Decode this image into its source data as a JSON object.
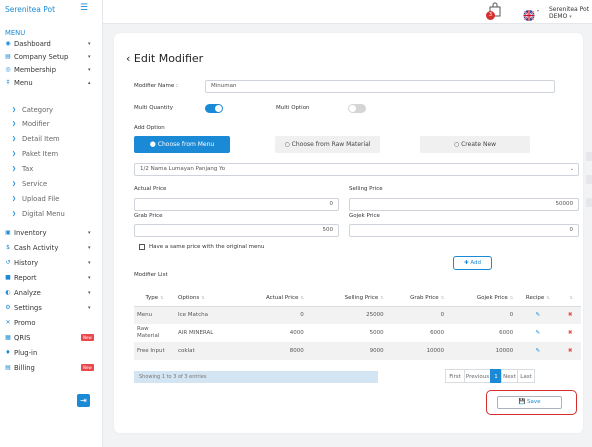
{
  "sidebar": {
    "brand": "Serenitea Pot",
    "menu_heading": "MENU",
    "items": [
      {
        "label": "Dashboard",
        "icon": "◉",
        "caret": "▾",
        "new": ""
      },
      {
        "label": "Company Setup",
        "icon": "▤",
        "caret": "▾",
        "new": ""
      },
      {
        "label": "Membership",
        "icon": "◎",
        "caret": "▾",
        "new": ""
      },
      {
        "label": "Menu",
        "icon": "‡",
        "caret": "▴",
        "new": ""
      },
      {
        "label": "Category",
        "icon": "❯",
        "sub": true
      },
      {
        "label": "Modifier",
        "icon": "❯",
        "sub": true
      },
      {
        "label": "Detail Item",
        "icon": "❯",
        "sub": true
      },
      {
        "label": "Paket Item",
        "icon": "❯",
        "sub": true
      },
      {
        "label": "Tax",
        "icon": "❯",
        "sub": true
      },
      {
        "label": "Service",
        "icon": "❯",
        "sub": true
      },
      {
        "label": "Upload File",
        "icon": "❯",
        "sub": true
      },
      {
        "label": "Digital Menu",
        "icon": "❯",
        "sub": true
      },
      {
        "label": "Inventory",
        "icon": "▣",
        "caret": "▾",
        "new": ""
      },
      {
        "label": "Cash Activity",
        "icon": "$",
        "caret": "▾",
        "new": ""
      },
      {
        "label": "History",
        "icon": "↺",
        "caret": "▾",
        "new": ""
      },
      {
        "label": "Report",
        "icon": "■",
        "caret": "▾",
        "new": ""
      },
      {
        "label": "Analyze",
        "icon": "◐",
        "caret": "▾",
        "new": ""
      },
      {
        "label": "Settings",
        "icon": "⚙",
        "caret": "▾",
        "new": ""
      },
      {
        "label": "Promo",
        "icon": "✕",
        "caret": "",
        "new": ""
      },
      {
        "label": "QRIS",
        "icon": "▦",
        "caret": "",
        "new": "New"
      },
      {
        "label": "Plug-in",
        "icon": "♦",
        "caret": "",
        "new": ""
      },
      {
        "label": "Billing",
        "icon": "▤",
        "caret": "",
        "new": "New"
      }
    ],
    "exit_icon": "⇥"
  },
  "topbar": {
    "cart_count": "3",
    "user": "Serenitea Pot DEMO",
    "flag": "UK"
  },
  "page": {
    "title": "Edit Modifier",
    "back_icon": "‹",
    "modifier_name_label": "Modifier Name :",
    "modifier_name_value": "Minuman",
    "multi_quantity_label": "Multi Quantity",
    "multi_quantity_on": true,
    "multi_option_label": "Multi Option",
    "multi_option_on": false,
    "add_option_label": "Add Option",
    "option_buttons": [
      "Choose from Menu",
      "Choose from Raw Material",
      "Create New"
    ],
    "selected_menu": "1/2 Nama Lumayan Panjang Yo",
    "actual_price_label": "Actual Price",
    "actual_price_value": "0",
    "selling_price_label": "Selling Price",
    "selling_price_value": "50000",
    "grab_price_label": "Grab Price",
    "grab_price_value": "500",
    "gojek_price_label": "Gojek Price",
    "gojek_price_value": "0",
    "same_price_label": "Have a same price with the original menu",
    "add_label": "Add",
    "modifier_list_label": "Modifier List"
  },
  "table": {
    "headers": [
      "Type",
      "Options",
      "Actual Price",
      "Selling Price",
      "Grab Price",
      "Gojek Price",
      "Recipe",
      ""
    ],
    "rows": [
      {
        "type": "Menu",
        "option": "Ice Matcha",
        "actual": "0",
        "selling": "25000",
        "grab": "0",
        "gojek": "0"
      },
      {
        "type": "Raw Material",
        "option": "AIR MINERAL",
        "actual": "4000",
        "selling": "5000",
        "grab": "6000",
        "gojek": "6000"
      },
      {
        "type": "Free Input",
        "option": "coklat",
        "actual": "8000",
        "selling": "9000",
        "grab": "10000",
        "gojek": "10000"
      }
    ],
    "info": "Showing 1 to 3 of 3 entries",
    "pagination": [
      "First",
      "Previous",
      "1",
      "Next",
      "Last"
    ]
  },
  "save_label": "Save",
  "colors": {
    "accent": "#1b8ad6",
    "danger": "#e8474b",
    "highlight": "#d32f2f"
  }
}
